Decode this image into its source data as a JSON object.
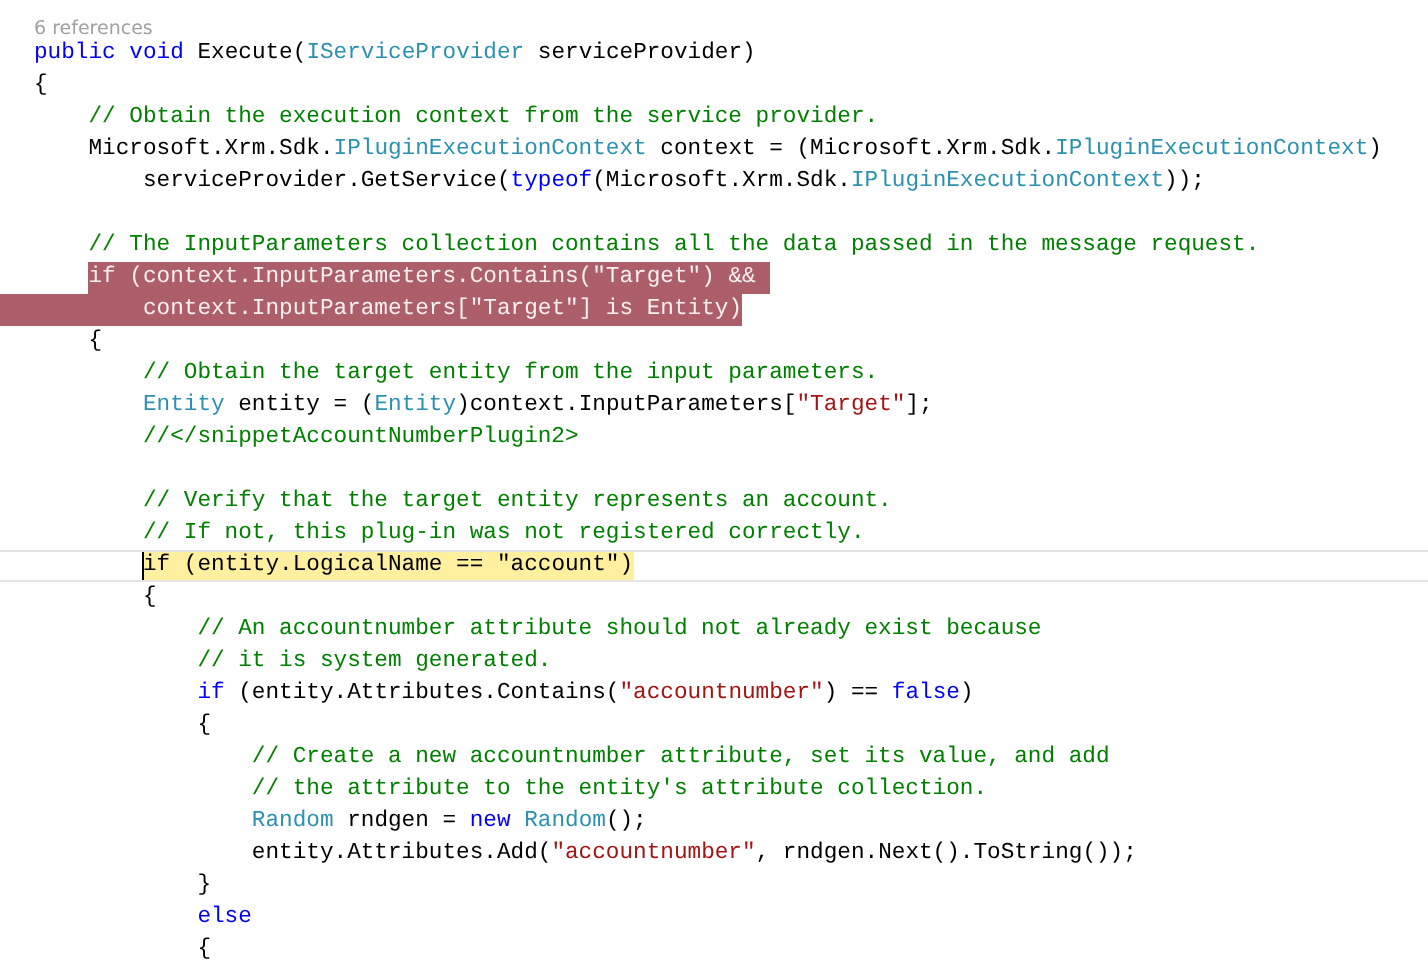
{
  "editor": {
    "codelens": "6 references",
    "lines": [
      {
        "selected": false,
        "current": false,
        "segments": [
          {
            "kind": "keyword",
            "text": "public"
          },
          {
            "kind": "keyword",
            "text": " void"
          },
          {
            "kind": "plain",
            "text": " Execute("
          },
          {
            "kind": "type",
            "text": "IServiceProvider"
          },
          {
            "kind": "plain",
            "text": " serviceProvider)"
          }
        ]
      },
      {
        "selected": false,
        "current": false,
        "segments": [
          {
            "kind": "plain",
            "text": "{"
          }
        ]
      },
      {
        "selected": false,
        "current": false,
        "segments": [
          {
            "kind": "comment",
            "text": "    // Obtain the execution context from the service provider."
          }
        ]
      },
      {
        "selected": false,
        "current": false,
        "segments": [
          {
            "kind": "plain",
            "text": "    Microsoft.Xrm.Sdk."
          },
          {
            "kind": "type",
            "text": "IPluginExecutionContext"
          },
          {
            "kind": "plain",
            "text": " context = (Microsoft.Xrm.Sdk."
          },
          {
            "kind": "type",
            "text": "IPluginExecutionContext"
          },
          {
            "kind": "plain",
            "text": ")"
          }
        ]
      },
      {
        "selected": false,
        "current": false,
        "segments": [
          {
            "kind": "plain",
            "text": "        serviceProvider.GetService("
          },
          {
            "kind": "keyword",
            "text": "typeof"
          },
          {
            "kind": "plain",
            "text": "(Microsoft.Xrm.Sdk."
          },
          {
            "kind": "type",
            "text": "IPluginExecutionContext"
          },
          {
            "kind": "plain",
            "text": "));"
          }
        ]
      },
      {
        "selected": false,
        "current": false
      },
      {
        "selected": false,
        "current": false,
        "segments": [
          {
            "kind": "comment",
            "text": "    // The InputParameters collection contains all the data passed in the message request."
          }
        ]
      },
      {
        "selected": true,
        "current": false,
        "segments": [
          {
            "kind": "keyword",
            "text": "    if"
          },
          {
            "kind": "plain",
            "text": " (context.InputParameters.Contains("
          },
          {
            "kind": "string",
            "text": "\"Target\""
          },
          {
            "kind": "plain",
            "text": ") && "
          }
        ]
      },
      {
        "selected": true,
        "current": false,
        "segments": [
          {
            "kind": "plain",
            "text": "        context.InputParameters["
          },
          {
            "kind": "string",
            "text": "\"Target\""
          },
          {
            "kind": "plain",
            "text": "] is Entity)"
          }
        ]
      },
      {
        "selected": false,
        "current": false,
        "segments": [
          {
            "kind": "plain",
            "text": "    {"
          }
        ]
      },
      {
        "selected": false,
        "current": false,
        "segments": [
          {
            "kind": "comment",
            "text": "        // Obtain the target entity from the input parameters."
          }
        ]
      },
      {
        "selected": false,
        "current": false,
        "segments": [
          {
            "kind": "type",
            "text": "        Entity"
          },
          {
            "kind": "plain",
            "text": " entity = ("
          },
          {
            "kind": "type",
            "text": "Entity"
          },
          {
            "kind": "plain",
            "text": ")context.InputParameters["
          },
          {
            "kind": "string",
            "text": "\"Target\""
          },
          {
            "kind": "plain",
            "text": "];"
          }
        ]
      },
      {
        "selected": false,
        "current": false,
        "segments": [
          {
            "kind": "comment",
            "text": "        //</snippetAccountNumberPlugin2>"
          }
        ]
      },
      {
        "selected": false,
        "current": false
      },
      {
        "selected": false,
        "current": false,
        "segments": [
          {
            "kind": "comment",
            "text": "        // Verify that the target entity represents an account."
          }
        ]
      },
      {
        "selected": false,
        "current": false,
        "segments": [
          {
            "kind": "comment",
            "text": "        // If not, this plug-in was not registered correctly."
          }
        ]
      },
      {
        "selected": false,
        "current": true,
        "segments": [
          {
            "kind": "plain",
            "text": "        if (entity.LogicalName == \"account\")"
          }
        ]
      },
      {
        "selected": false,
        "current": false,
        "segments": [
          {
            "kind": "plain",
            "text": "        {"
          }
        ]
      },
      {
        "selected": false,
        "current": false,
        "segments": [
          {
            "kind": "comment",
            "text": "            // An accountnumber attribute should not already exist because"
          }
        ]
      },
      {
        "selected": false,
        "current": false,
        "segments": [
          {
            "kind": "comment",
            "text": "            // it is system generated."
          }
        ]
      },
      {
        "selected": false,
        "current": false,
        "segments": [
          {
            "kind": "keyword",
            "text": "            if"
          },
          {
            "kind": "plain",
            "text": " (entity.Attributes.Contains("
          },
          {
            "kind": "string",
            "text": "\"accountnumber\""
          },
          {
            "kind": "plain",
            "text": ") == "
          },
          {
            "kind": "keyword",
            "text": "false"
          },
          {
            "kind": "plain",
            "text": ")"
          }
        ]
      },
      {
        "selected": false,
        "current": false,
        "segments": [
          {
            "kind": "plain",
            "text": "            {"
          }
        ]
      },
      {
        "selected": false,
        "current": false,
        "segments": [
          {
            "kind": "comment",
            "text": "                // Create a new accountnumber attribute, set its value, and add"
          }
        ]
      },
      {
        "selected": false,
        "current": false,
        "segments": [
          {
            "kind": "comment",
            "text": "                // the attribute to the entity's attribute collection."
          }
        ]
      },
      {
        "selected": false,
        "current": false,
        "segments": [
          {
            "kind": "type",
            "text": "                Random"
          },
          {
            "kind": "plain",
            "text": " rndgen = "
          },
          {
            "kind": "keyword",
            "text": "new"
          },
          {
            "kind": "type",
            "text": " Random"
          },
          {
            "kind": "plain",
            "text": "();"
          }
        ]
      },
      {
        "selected": false,
        "current": false,
        "segments": [
          {
            "kind": "plain",
            "text": "                entity.Attributes.Add("
          },
          {
            "kind": "string",
            "text": "\"accountnumber\""
          },
          {
            "kind": "plain",
            "text": ", rndgen.Next().ToString());"
          }
        ]
      },
      {
        "selected": false,
        "current": false,
        "segments": [
          {
            "kind": "plain",
            "text": "            }"
          }
        ]
      },
      {
        "selected": false,
        "current": false,
        "segments": [
          {
            "kind": "keyword",
            "text": "            else"
          }
        ]
      },
      {
        "selected": false,
        "current": false,
        "segments": [
          {
            "kind": "plain",
            "text": "            {"
          }
        ]
      }
    ]
  }
}
